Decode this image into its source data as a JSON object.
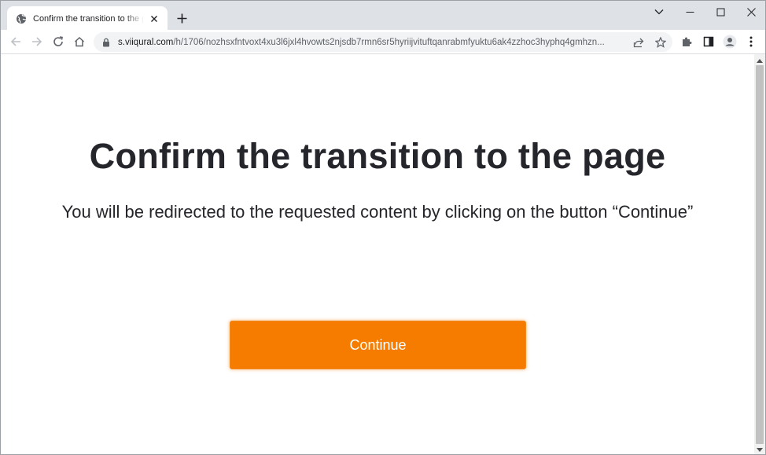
{
  "browser": {
    "tab": {
      "title": "Confirm the transition to the page",
      "favicon": "globe-icon"
    },
    "new_tab_icon": "plus-icon",
    "window_controls": [
      "chevron-down-icon",
      "minimize-icon",
      "maximize-icon",
      "close-icon"
    ],
    "toolbar": {
      "back": "arrow-left-icon",
      "forward": "arrow-right-icon",
      "reload": "reload-icon",
      "home": "home-icon",
      "url_host": "s.viiqural.com",
      "url_path": "/h/1706/nozhsxfntvoxt4xu3l6jxl4hvowts2njsdb7rmn6sr5hyriijvituftqanrabmfyuktu6ak4zzhoc3hyphq4gmhzn...",
      "share": "share-icon",
      "bookmark": "star-icon",
      "extensions": "puzzle-icon",
      "side_panel": "side-panel-icon",
      "profile": "profile-icon",
      "menu": "kebab-menu-icon"
    }
  },
  "page": {
    "heading": "Confirm the transition to the page",
    "subtext": "You will be redirected to the requested content by clicking on the button “Continue”",
    "button_label": "Continue"
  },
  "colors": {
    "button": "#f67c00",
    "heading_text": "#25262b",
    "tabstrip": "#dee1e6",
    "omnibox": "#f1f3f4"
  }
}
